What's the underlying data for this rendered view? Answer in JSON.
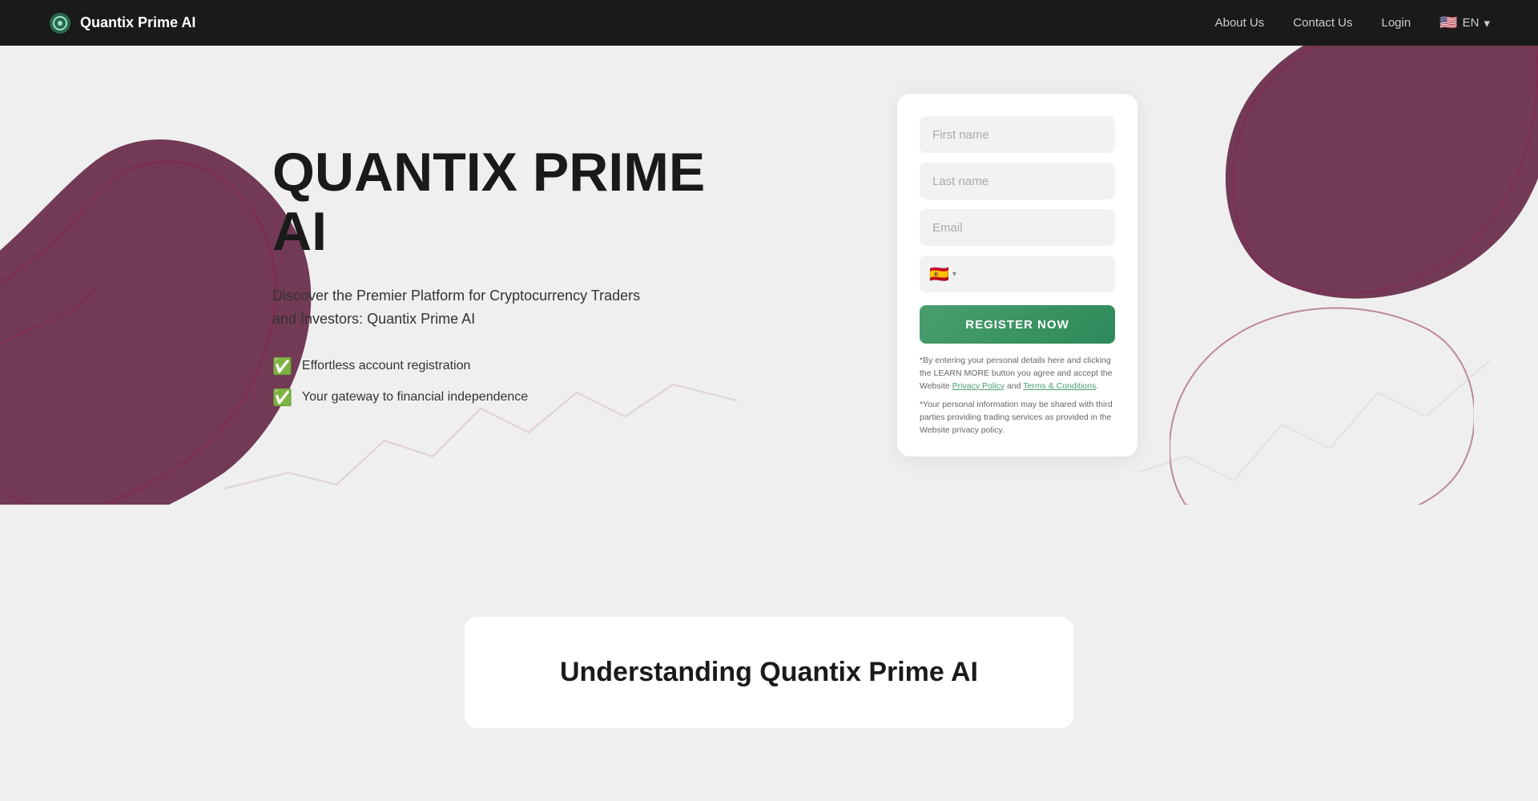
{
  "navbar": {
    "brand_name": "Quantix Prime AI",
    "links": [
      {
        "label": "About Us",
        "id": "about-us"
      },
      {
        "label": "Contact Us",
        "id": "contact-us"
      },
      {
        "label": "Login",
        "id": "login"
      }
    ],
    "lang": {
      "flag": "🇺🇸",
      "code": "EN",
      "arrow": "▾"
    }
  },
  "hero": {
    "title_line1": "QUANTIX PRIME",
    "title_line2": "AI",
    "subtitle": "Discover the Premier Platform for Cryptocurrency Traders and Investors: Quantix Prime AI",
    "features": [
      "Effortless account registration",
      "Your gateway to financial independence"
    ]
  },
  "form": {
    "first_name_placeholder": "First name",
    "last_name_placeholder": "Last name",
    "email_placeholder": "Email",
    "phone_flag": "🇪🇸",
    "phone_arrow": "▾",
    "register_button": "REGISTER NOW",
    "disclaimer_text": "*By entering your personal details here and clicking the LEARN MORE button you agree and accept the Website ",
    "privacy_policy_link": "Privacy Policy",
    "and_text": " and ",
    "terms_link": "Terms & Conditions",
    "disclaimer_end": ".",
    "privacy_text": "*Your personal information may be shared with third parties providing trading services as provided in the Website privacy policy."
  },
  "understanding": {
    "title": "Understanding Quantix Prime AI"
  }
}
